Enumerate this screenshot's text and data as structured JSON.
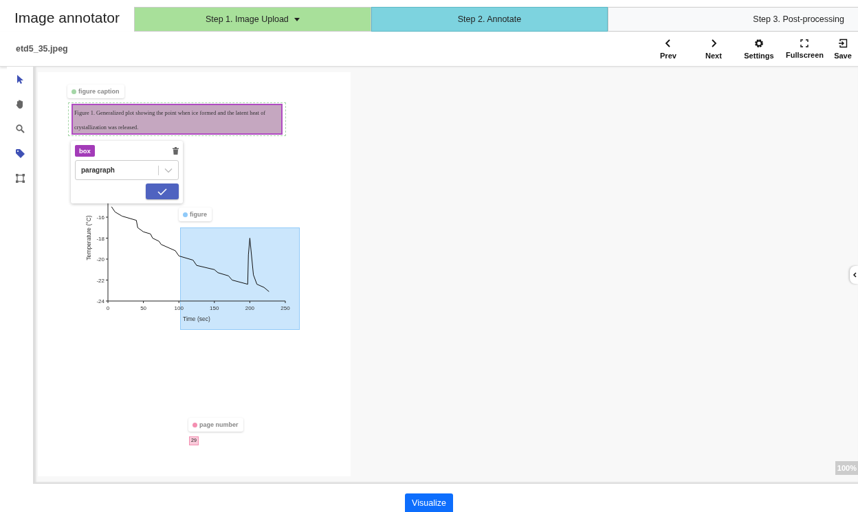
{
  "app_title": "Image annotator",
  "steps": [
    {
      "label": "Step 1. Image Upload",
      "completed": true,
      "selected": false,
      "dropdown": true
    },
    {
      "label": "Step 2. Annotate",
      "completed": false,
      "selected": true,
      "dropdown": false
    },
    {
      "label": "Step 3. Post-processing",
      "completed": false,
      "selected": false,
      "dropdown": false
    }
  ],
  "file_name": "etd5_35.jpeg",
  "actions": [
    {
      "label": "Prev",
      "kind": "prev"
    },
    {
      "label": "Next",
      "kind": "next"
    },
    {
      "label": "Settings",
      "kind": "settings"
    },
    {
      "label": "Fullscreen",
      "kind": "fullscreen"
    },
    {
      "label": "Save",
      "kind": "save"
    }
  ],
  "tools": [
    {
      "kind": "select",
      "selected": true
    },
    {
      "kind": "pan",
      "selected": false
    },
    {
      "kind": "zoom",
      "selected": false
    },
    {
      "kind": "tag",
      "selected": true
    },
    {
      "kind": "box",
      "selected": false
    }
  ],
  "document": {
    "caption_text": "Figure 1. Generalized plot showing the point when ice formed and the latent heat of crystallization was released.",
    "page_number": "29",
    "chart_data": {
      "type": "line",
      "xlabel": "Time (sec)",
      "ylabel": "Temperature (°C)",
      "xlim": [
        0,
        250
      ],
      "ylim": [
        -24,
        -12
      ],
      "xticks": [
        0,
        50,
        100,
        150,
        200,
        250
      ],
      "yticks": [
        -24,
        -22,
        -20,
        -18,
        -16
      ],
      "x": [
        5,
        10,
        20,
        40,
        42,
        50,
        60,
        63,
        72,
        75,
        95,
        100,
        120,
        125,
        150,
        155,
        170,
        175,
        197,
        198,
        200,
        205,
        210,
        220,
        227
      ],
      "series": [
        {
          "color": "#111111",
          "values": [
            -15.0,
            -15.5,
            -15.9,
            -16.3,
            -17,
            -17.4,
            -17.6,
            -18,
            -18.3,
            -18.6,
            -19.2,
            -19.7,
            -20.1,
            -20.6,
            -21,
            -21.3,
            -21.6,
            -22,
            -22.4,
            -19.6,
            -18,
            -21.5,
            -22.4,
            -22.7,
            -23.1
          ]
        }
      ]
    }
  },
  "regions": [
    {
      "label": "figure caption",
      "color": "#a5d6a7",
      "selected": true
    },
    {
      "label": "figure",
      "color": "#90caf9",
      "selected": false
    },
    {
      "label": "page number",
      "color": "#f48fb1",
      "selected": false
    }
  ],
  "editor": {
    "tag": "box",
    "class_value": "paragraph"
  },
  "zoom_level": "100%",
  "visualize_button": "Visualize"
}
